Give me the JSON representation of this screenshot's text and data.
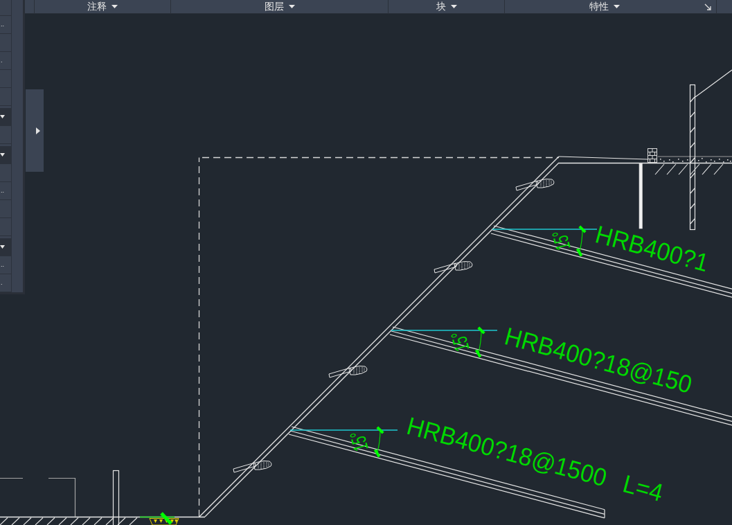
{
  "ribbon": {
    "panels": [
      {
        "title": "注释"
      },
      {
        "title": "图层"
      },
      {
        "title": "块"
      },
      {
        "title": "特性"
      }
    ]
  },
  "tool_palette": {
    "rows": [
      {
        "kind": "button"
      },
      {
        "kind": "button",
        "label": ".."
      },
      {
        "kind": "button"
      },
      {
        "kind": "button",
        "label": "."
      },
      {
        "kind": "button"
      },
      {
        "kind": "button"
      },
      {
        "kind": "dropdown"
      },
      {
        "kind": "button"
      },
      {
        "kind": "dropdown"
      },
      {
        "kind": "button"
      },
      {
        "kind": "button",
        "label": ".."
      },
      {
        "kind": "button"
      },
      {
        "kind": "button"
      },
      {
        "kind": "dropdown"
      },
      {
        "kind": "button",
        "label": ".."
      },
      {
        "kind": "button",
        "label": "."
      }
    ]
  },
  "drawing": {
    "anchors": [
      {
        "angle_label": "15°",
        "rebar_label": "HRB400?1"
      },
      {
        "angle_label": "15°",
        "rebar_label": "HRB400?18@150"
      },
      {
        "angle_label": "15°",
        "rebar_label": "HRB400?18@1500",
        "length_label": "L=4"
      }
    ]
  }
}
